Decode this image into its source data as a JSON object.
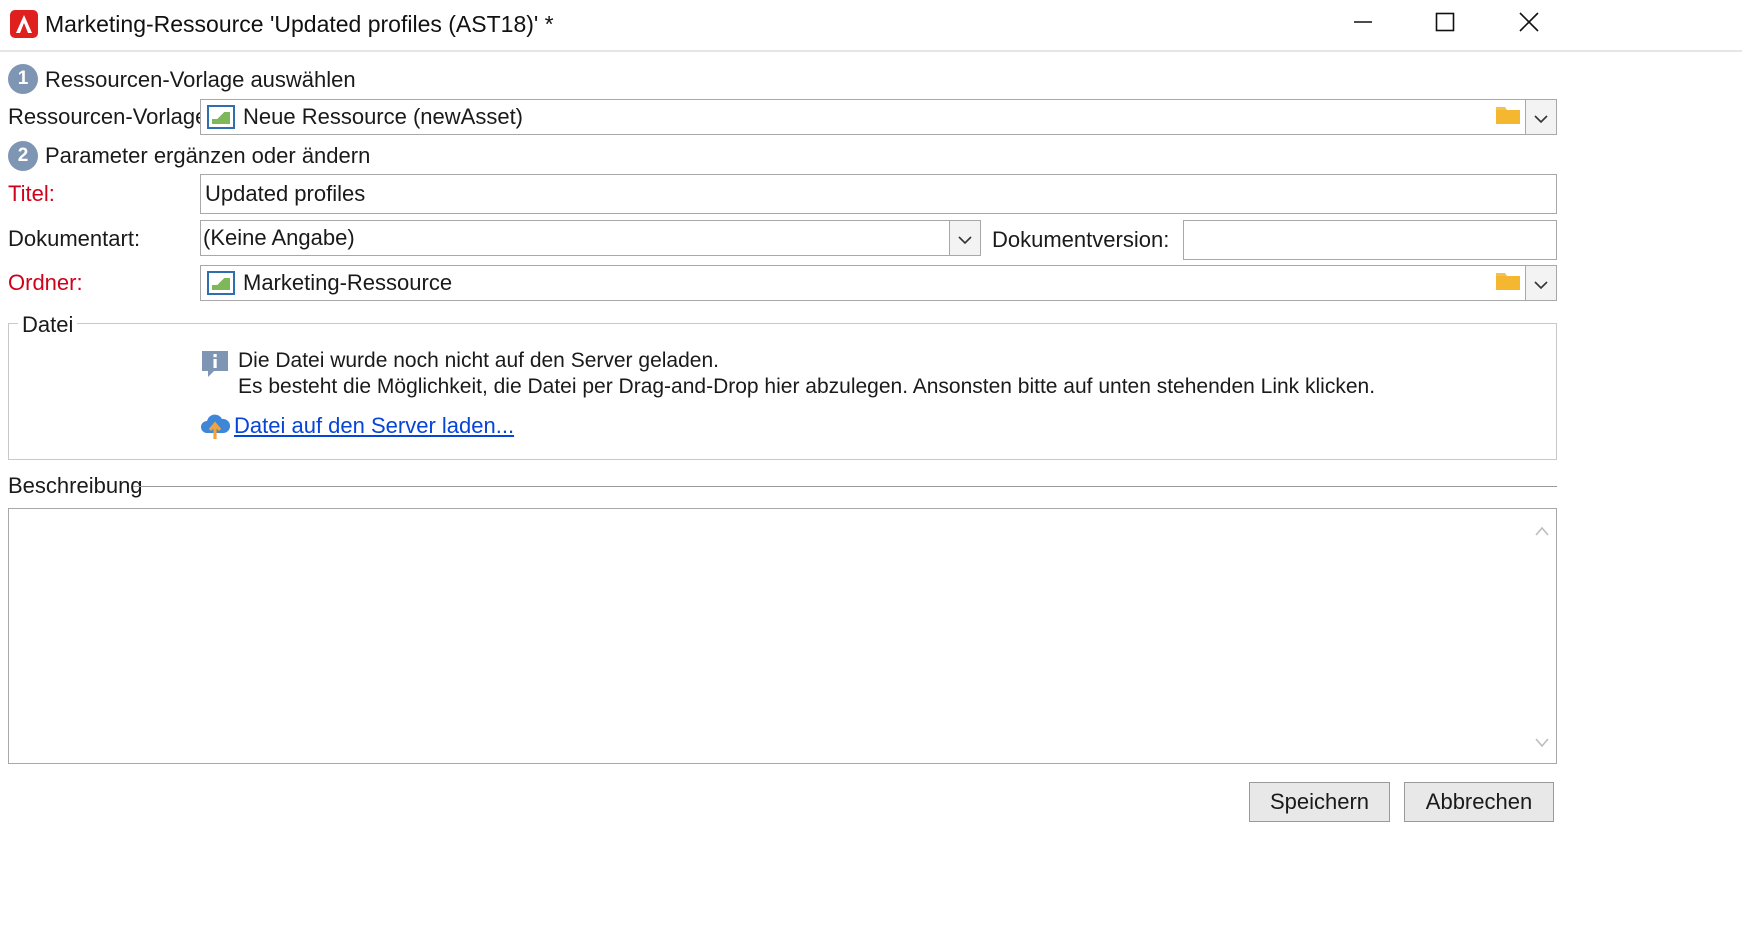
{
  "window": {
    "title_prefix": "Marketing-Ressource",
    "title_suffix": "'Updated profiles (AST18)' *"
  },
  "step1": {
    "number": "1",
    "label": "Ressourcen-Vorlage auswählen"
  },
  "template_field": {
    "label": "Ressourcen-Vorlage:",
    "value": "Neue Ressource (newAsset)"
  },
  "step2": {
    "number": "2",
    "label": "Parameter ergänzen oder ändern"
  },
  "title_field": {
    "label": "Titel:",
    "value": "Updated profiles"
  },
  "doctype_field": {
    "label": "Dokumentart:",
    "value": "(Keine Angabe)"
  },
  "docversion_field": {
    "label": "Dokumentversion:",
    "value": ""
  },
  "folder_field": {
    "label": "Ordner:",
    "value": "Marketing-Ressource"
  },
  "file_group": {
    "legend": "Datei",
    "info_line1": "Die Datei wurde noch nicht auf den Server geladen.",
    "info_line2": "Es besteht die Möglichkeit, die Datei per Drag-and-Drop hier abzulegen. Ansonsten bitte auf unten stehenden Link klicken.",
    "upload_link": "Datei auf den Server laden..."
  },
  "description": {
    "legend": "Beschreibung",
    "value": ""
  },
  "buttons": {
    "save_label": "Speichern",
    "cancel_label": "Abbrechen"
  },
  "colors": {
    "required": "#d0021b",
    "step_circle": "#7f95b4",
    "app_icon": "#e01f1f",
    "link": "#0645d6"
  },
  "icons": [
    "adobe-campaign-icon",
    "minimize-icon",
    "maximize-icon",
    "close-icon",
    "asset-image-icon",
    "folder-icon",
    "chevron-down-icon",
    "info-icon",
    "upload-cloud-icon",
    "scroll-up-icon",
    "scroll-down-icon"
  ]
}
